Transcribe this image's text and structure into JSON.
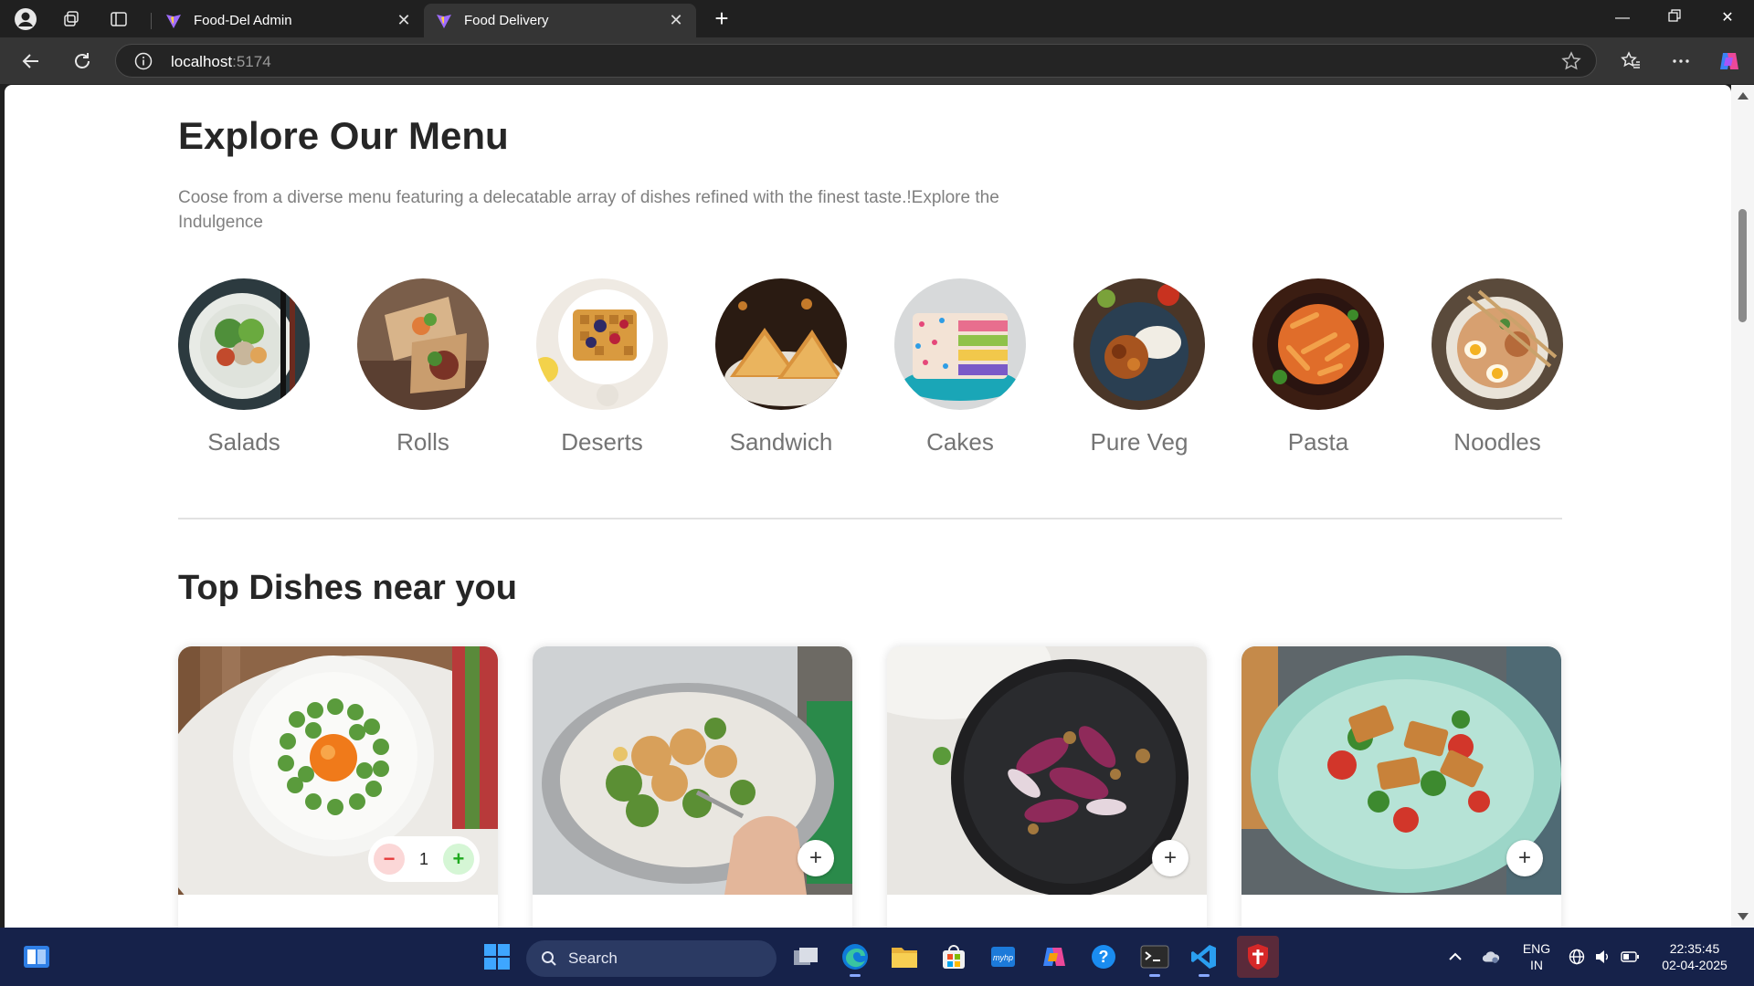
{
  "browser": {
    "tabs": [
      {
        "title": "Food-Del Admin",
        "active": false
      },
      {
        "title": "Food Delivery",
        "active": true
      }
    ],
    "url_host": "localhost",
    "url_port": ":5174"
  },
  "page": {
    "menu_title": "Explore Our Menu",
    "menu_description": "Coose from a diverse menu featuring a delecatable array of dishes refined with the finest taste.!Explore the Indulgence",
    "categories": [
      {
        "label": "Salads",
        "icon": "salad-image"
      },
      {
        "label": "Rolls",
        "icon": "rolls-image"
      },
      {
        "label": "Deserts",
        "icon": "deserts-image"
      },
      {
        "label": "Sandwich",
        "icon": "sandwich-image"
      },
      {
        "label": "Cakes",
        "icon": "cakes-image"
      },
      {
        "label": "Pure Veg",
        "icon": "pure-veg-image"
      },
      {
        "label": "Pasta",
        "icon": "pasta-image"
      },
      {
        "label": "Noodles",
        "icon": "noodles-image"
      }
    ],
    "dishes_title": "Top Dishes near you",
    "dishes": [
      {
        "image": "asparagus-egg-salad-image",
        "quantity": "1",
        "minus_label": "−",
        "plus_label": "+"
      },
      {
        "image": "greek-salad-image",
        "add_label": "+"
      },
      {
        "image": "endive-salad-image",
        "add_label": "+"
      },
      {
        "image": "halloumi-salad-image",
        "add_label": "+"
      }
    ]
  },
  "taskbar": {
    "search_placeholder": "Search",
    "lang_line1": "ENG",
    "lang_line2": "IN",
    "time": "22:35:45",
    "date": "02-04-2025"
  },
  "colors": {
    "heading": "#262626",
    "muted_text": "#808080",
    "taskbar": "#16224a",
    "browser_chrome": "#353535"
  }
}
